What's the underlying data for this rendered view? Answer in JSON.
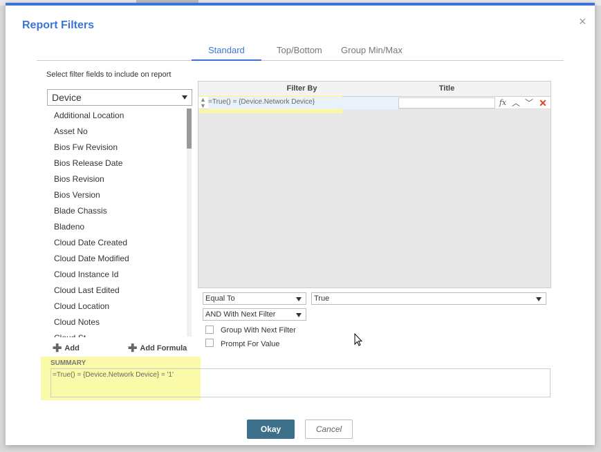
{
  "dialog": {
    "title": "Report Filters",
    "close_glyph": "×",
    "tabs": [
      "Standard",
      "Top/Bottom",
      "Group Min/Max"
    ],
    "instruction": "Select filter fields to include on report",
    "entity_select": "Device",
    "fields": [
      "Additional Location",
      "Asset No",
      "Bios Fw Revision",
      "Bios Release Date",
      "Bios Revision",
      "Bios Version",
      "Blade Chassis",
      "Bladeno",
      "Cloud Date Created",
      "Cloud Date Modified",
      "Cloud Instance Id",
      "Cloud Last Edited",
      "Cloud Location",
      "Cloud Notes",
      "Cloud St..."
    ],
    "add_label": "Add",
    "add_formula_label": "Add Formula",
    "grid": {
      "headers": {
        "filter_by": "Filter By",
        "title": "Title"
      },
      "rows": [
        {
          "filter": "=True() = {Device.Network Device}",
          "title": ""
        }
      ],
      "icons": {
        "fx": "fx",
        "up": "^",
        "down": "v",
        "delete": "X"
      }
    },
    "operator_select": "Equal To",
    "value_select": "True",
    "combine_select": "AND With Next Filter",
    "group_with_next": "Group With Next Filter",
    "prompt_for_value": "Prompt For Value",
    "summary_label": "SUMMARY",
    "summary_text": "=True() = {Device.Network Device} = '1'",
    "okay_label": "Okay",
    "cancel_label": "Cancel"
  },
  "colors": {
    "accent": "#3b74d8",
    "primary_button": "#3c6f8a",
    "highlight": "#fafaa0",
    "delete": "#d42"
  }
}
